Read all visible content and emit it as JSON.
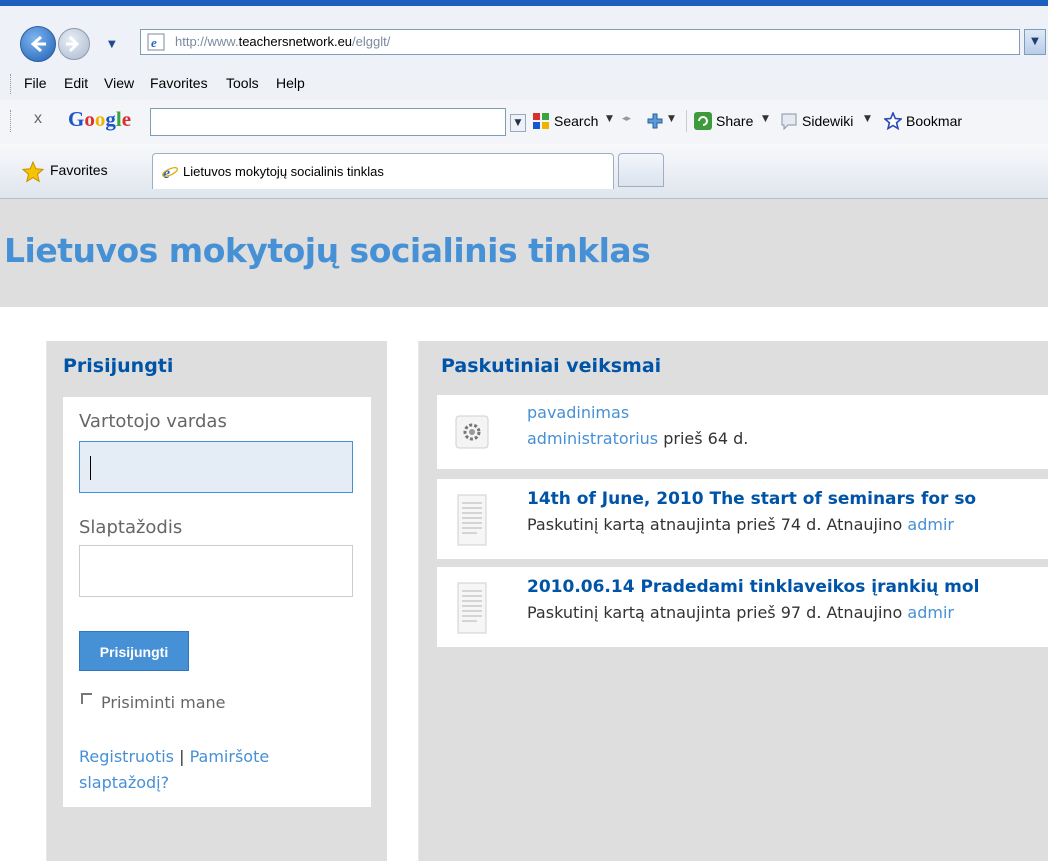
{
  "browser": {
    "url_prefix": "http://www.",
    "url_domain": "teachersnetwork.eu",
    "url_suffix": "/elgglt/",
    "menu": [
      "File",
      "Edit",
      "View",
      "Favorites",
      "Tools",
      "Help"
    ],
    "google_toolbar": {
      "close": "x",
      "logo": "Google",
      "search_label": "Search",
      "share_label": "Share",
      "sidewiki_label": "Sidewiki",
      "bookmarks_label": "Bookmar"
    },
    "favorites_label": "Favorites",
    "tab_title": "Lietuvos mokytojų socialinis tinklas"
  },
  "site": {
    "title": "Lietuvos mokytojų socialinis tinklas"
  },
  "login": {
    "heading": "Prisijungti",
    "username_label": "Vartotojo vardas",
    "username_value": "",
    "password_label": "Slaptažodis",
    "password_value": "",
    "submit_label": "Prisijungti",
    "remember_label": "Prisiminti mane",
    "register_link": "Registruotis",
    "separator": "|",
    "forgot_link_line1": "Pamiršote",
    "forgot_link_line2": "slaptažodį?"
  },
  "activity": {
    "heading": "Paskutiniai veiksmai",
    "items": [
      {
        "icon": "settings-icon",
        "title": "pavadinimas",
        "author": "administratorius",
        "meta_suffix": " prieš 64 d."
      },
      {
        "icon": "document-icon",
        "title": "14th of June, 2010 The start of seminars for so",
        "meta_prefix": "Paskutinį kartą atnaujinta prieš 74 d. Atnaujino ",
        "author": "admir"
      },
      {
        "icon": "document-icon",
        "title": "2010.06.14 Pradedami tinklaveikos įrankių mol",
        "meta_prefix": "Paskutinį kartą atnaujinta prieš 97 d. Atnaujino ",
        "author": "admir"
      }
    ]
  },
  "colors": {
    "accent": "#4690d6",
    "heading_blue": "#0054a7",
    "panel_grey": "#dedede"
  }
}
